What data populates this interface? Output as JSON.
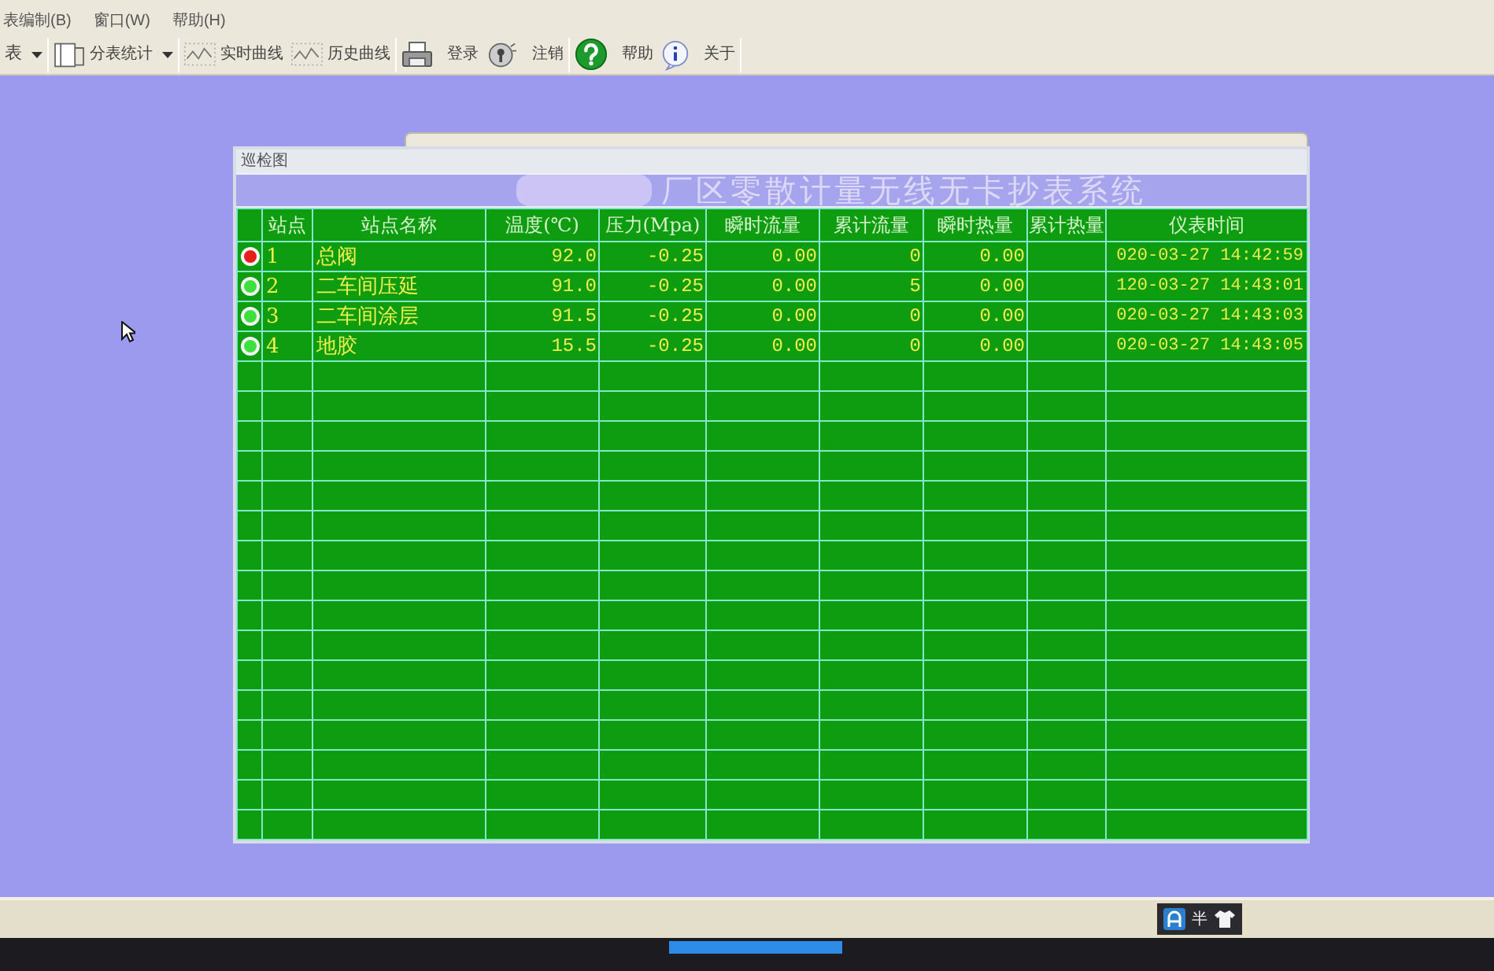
{
  "menu_bar": {
    "items": [
      "表编制(B)",
      "窗口(W)",
      "帮助(H)"
    ]
  },
  "toolbar": {
    "groups": [
      [
        {
          "kind": "dropdown",
          "label": "表"
        }
      ],
      [
        {
          "kind": "dropdown",
          "label": "分表统计"
        }
      ],
      [
        {
          "kind": "button",
          "label": "实时曲线"
        },
        {
          "kind": "button",
          "label": "历史曲线"
        }
      ],
      [
        {
          "kind": "button",
          "label": "登录"
        },
        {
          "kind": "button",
          "label": "注销"
        }
      ],
      [
        {
          "kind": "button",
          "label": "帮助"
        },
        {
          "kind": "button",
          "label": "关于"
        }
      ]
    ]
  },
  "window": {
    "title": "巡检图",
    "banner": "厂区零散计量无线无卡抄表系统"
  },
  "table": {
    "columns": [
      "站点",
      "站点名称",
      "温度(℃)",
      "压力(Mpa)",
      "瞬时流量",
      "累计流量",
      "瞬时热量",
      "累计热量",
      "仪表时间"
    ],
    "rows": [
      {
        "color": "#e81c1c",
        "station": "1",
        "name": "总阀",
        "temperature": "92.0",
        "pressure": "-0.25",
        "instant_flow": "0.00",
        "total_flow": "0",
        "instant_heat": "0.00",
        "meter_time": "020-03-27 14:42:59"
      },
      {
        "color": "#3ee03e",
        "station": "2",
        "name": "二车间压延",
        "temperature": "91.0",
        "pressure": "-0.25",
        "instant_flow": "0.00",
        "total_flow": "5",
        "instant_heat": "0.00",
        "meter_time": "120-03-27 14:43:01"
      },
      {
        "color": "#3ee03e",
        "station": "3",
        "name": "二车间涂层",
        "temperature": "91.5",
        "pressure": "-0.25",
        "instant_flow": "0.00",
        "total_flow": "0",
        "instant_heat": "0.00",
        "meter_time": "020-03-27 14:43:03"
      },
      {
        "color": "#3ee03e",
        "station": "4",
        "name": "地胶",
        "temperature": "15.5",
        "pressure": "-0.25",
        "instant_flow": "0.00",
        "total_flow": "0",
        "instant_heat": "0.00",
        "meter_time": "020-03-27 14:43:05"
      }
    ]
  },
  "taskbar": {
    "ime_mode": "半"
  }
}
